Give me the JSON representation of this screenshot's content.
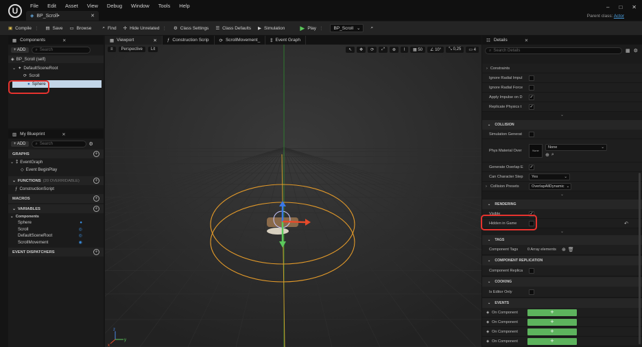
{
  "app": {
    "logo": "U",
    "menu": [
      "File",
      "Edit",
      "Asset",
      "View",
      "Debug",
      "Window",
      "Tools",
      "Help"
    ],
    "doc_tab": "BP_Scroll•",
    "parent_class_label": "Parent class:",
    "parent_class_value": "Actor",
    "window_controls": [
      "–",
      "□",
      "✕"
    ]
  },
  "toolbar": {
    "compile": "Compile",
    "save": "Save",
    "browse": "Browse",
    "find": "Find",
    "hide_unrelated": "Hide Unrelated",
    "class_settings": "Class Settings",
    "class_defaults": "Class Defaults",
    "simulation": "Simulation",
    "play": "Play",
    "debug_object": "BP_Scroll"
  },
  "components": {
    "tab": "Components",
    "add": "+ ADD",
    "search_placeholder": "Search",
    "self_item": "BP_Scroll (self)",
    "items": [
      "DefaultSceneRoot",
      "Scroll",
      "Sphere"
    ]
  },
  "blueprint": {
    "tab": "My Blueprint",
    "add": "+ ADD",
    "search_placeholder": "Search",
    "graphs_header": "GRAPHS",
    "event_graph": "EventGraph",
    "event_begin_play": "Event BeginPlay",
    "functions_header": "FUNCTIONS",
    "functions_count": "(20 OVERRIDABLE)",
    "construction_script": "ConstructionScript",
    "macros_header": "MACROS",
    "variables_header": "VARIABLES",
    "components_group": "Components",
    "variables": [
      "Sphere",
      "Scroll",
      "DefaultSceneRoot",
      "ScrollMovement"
    ],
    "event_dispatchers_header": "EVENT DISPATCHERS"
  },
  "viewport": {
    "tabs": [
      "Viewport",
      "Construction Scrip",
      "ScrollMovement_",
      "Event Graph"
    ],
    "perspective": "Perspective",
    "lit": "Lit",
    "grid_snap": "50",
    "rot_snap": "10°",
    "scale_snap": "0,25",
    "cam_speed": "4",
    "axis_labels": [
      "z",
      "y",
      "x"
    ]
  },
  "details": {
    "tab": "Details",
    "search_placeholder": "Search Details",
    "constraints": "Constraints",
    "physics_rows": [
      {
        "label": "Ignore Radial Impul",
        "checked": false
      },
      {
        "label": "Ignore Radial Force",
        "checked": false
      },
      {
        "label": "Apply Impulse on D",
        "checked": true
      },
      {
        "label": "Replicate Physics t",
        "checked": true
      }
    ],
    "collision_header": "COLLISION",
    "simulation_generates": "Simulation Generat",
    "phys_material": "Phys Material Over",
    "phys_material_thumb": "None",
    "phys_material_value": "None",
    "generate_overlap": "Generate Overlap E",
    "can_character_step": "Can Character Step",
    "can_character_step_value": "Yes",
    "collision_presets": "Collision Presets",
    "collision_presets_value": "OverlapAllDynamic",
    "rendering_header": "RENDERING",
    "visible": "Visible",
    "hidden_in_game": "Hidden in Game",
    "tags_header": "TAGS",
    "component_tags": "Component Tags",
    "component_tags_value": "0 Array elements",
    "replication_header": "COMPONENT REPLICATION",
    "component_replicates": "Component Replica",
    "cooking_header": "COOKING",
    "is_editor_only": "Is Editor Only",
    "events_header": "EVENTS",
    "events": [
      "On Component",
      "On Component",
      "On Component",
      "On Component"
    ]
  },
  "colors": {
    "accent_green": "#5db35d",
    "highlight_red": "#e8332e",
    "selection": "#c3d6e8",
    "gizmo_orange": "#e39a2a"
  }
}
